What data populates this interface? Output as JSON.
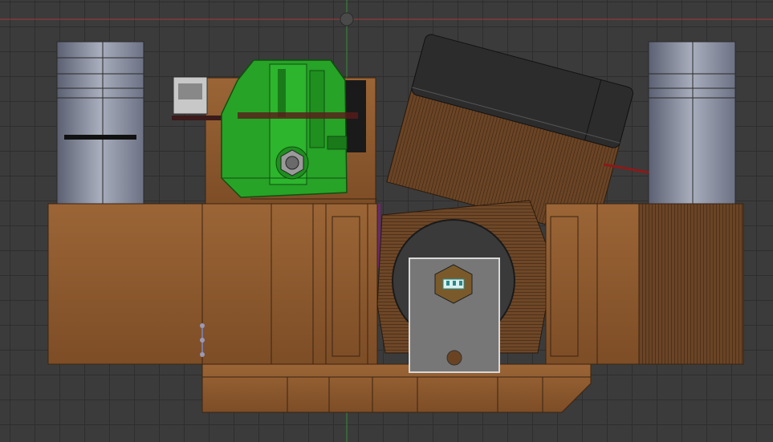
{
  "app": {
    "view": "3D viewport"
  },
  "viewport": {
    "grid": "on",
    "axis_x_color": "#a33a3a",
    "axis_y_color": "#3a8a3a",
    "background_color": "#3b3b3b"
  },
  "model": {
    "colors": {
      "body": "#8a5a30",
      "body_light": "#a56d3c",
      "body_dark": "#6b4322",
      "extruder": "#27a327",
      "extruder_dark": "#1a7a1a",
      "fan": "#2c2c2c",
      "coil": "#5a3a1e",
      "fan_duct": "#8c93a5",
      "plate": "#777777",
      "nozzle": "#7a5a2a",
      "accent": "#6a2a6a"
    },
    "icons": [
      "origin-gizmo-icon",
      "hex-bolt-icon",
      "nozzle-hex-icon"
    ]
  }
}
